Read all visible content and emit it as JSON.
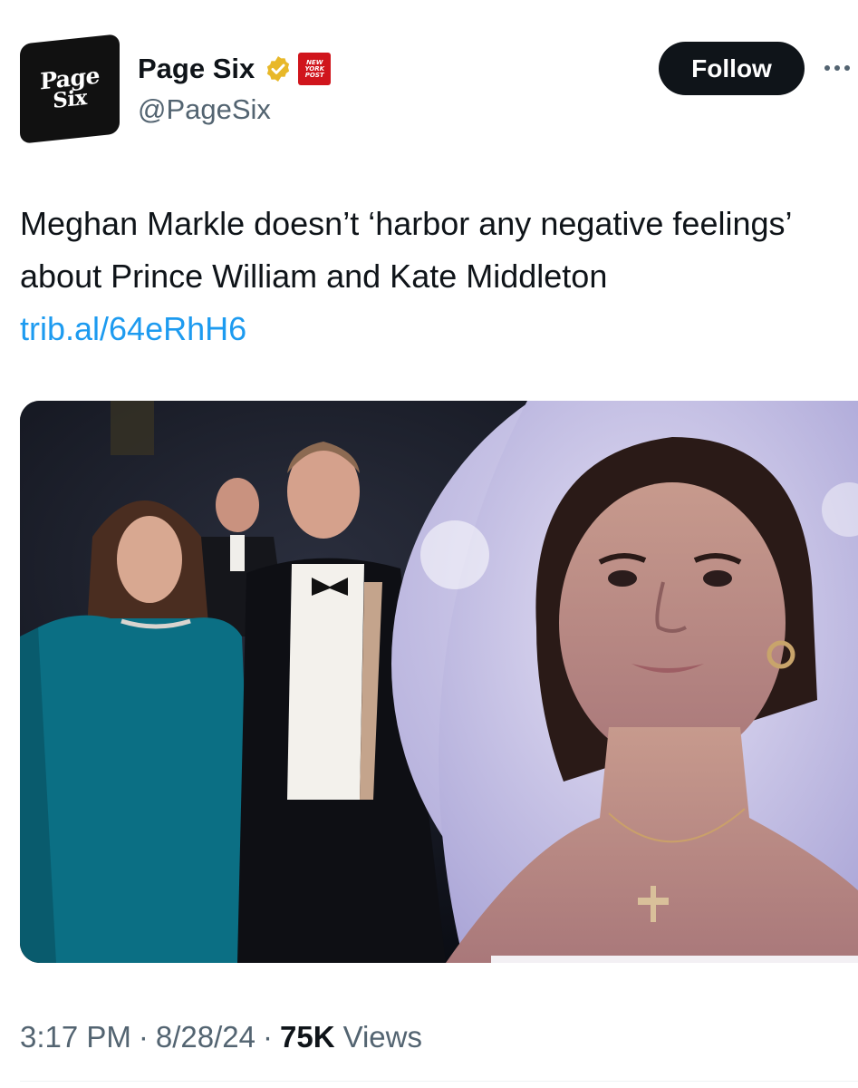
{
  "account": {
    "avatar_line1": "Page",
    "avatar_line2": "Six",
    "name": "Page Six",
    "handle": "@PageSix",
    "affiliate_badge": [
      "NEW",
      "YORK",
      "POST"
    ],
    "verified_icon": "gold-verified-badge-icon"
  },
  "actions": {
    "follow_label": "Follow",
    "more_icon": "more-dots-icon"
  },
  "tweet": {
    "text": "Meghan Markle doesn’t ‘harbor any negative feelings’ about Prince William and Kate Middleton ",
    "link": "trib.al/64eRhH6"
  },
  "meta": {
    "time": "3:17 PM",
    "separator": "·",
    "date": "8/28/24",
    "views_count": "75K",
    "views_label": "Views"
  },
  "colors": {
    "text_primary": "#0f1419",
    "text_secondary": "#536471",
    "link": "#1d9bf0",
    "follow_bg": "#0f1419",
    "verified_gold": "#e8b829",
    "nyp_red": "#d0151c"
  }
}
